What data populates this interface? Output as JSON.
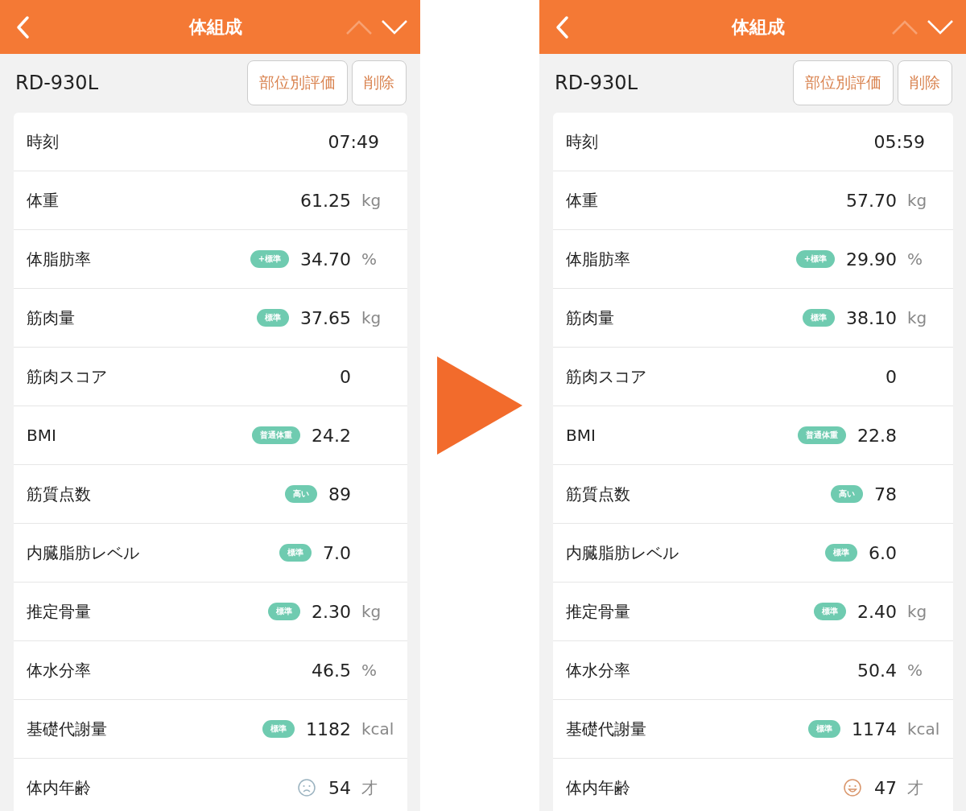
{
  "screens": [
    {
      "header": {
        "title": "体組成",
        "prev_disabled": true,
        "next_disabled": false
      },
      "device": "RD-930L",
      "buttons": [
        "部位別評価",
        "削除"
      ],
      "rows": [
        {
          "kind": "time",
          "label": "時刻",
          "value": "07:49"
        },
        {
          "kind": "measure",
          "label": "体重",
          "value": "61.25",
          "unit": "kg"
        },
        {
          "kind": "measure",
          "label": "体脂肪率",
          "badge": "+標準",
          "value": "34.70",
          "unit": "%"
        },
        {
          "kind": "measure",
          "label": "筋肉量",
          "badge": "標準",
          "value": "37.65",
          "unit": "kg"
        },
        {
          "kind": "measure",
          "label": "筋肉スコア",
          "value": "0"
        },
        {
          "kind": "measure",
          "label": "BMI",
          "badge": "普通体重",
          "value": "24.2"
        },
        {
          "kind": "measure",
          "label": "筋質点数",
          "badge": "高い",
          "value": "89"
        },
        {
          "kind": "measure",
          "label": "内臓脂肪レベル",
          "badge": "標準",
          "value": "7.0"
        },
        {
          "kind": "measure",
          "label": "推定骨量",
          "badge": "標準",
          "value": "2.30",
          "unit": "kg"
        },
        {
          "kind": "measure",
          "label": "体水分率",
          "value": "46.5",
          "unit": "%"
        },
        {
          "kind": "measure",
          "label": "基礎代謝量",
          "badge": "標準",
          "value": "1182",
          "unit": "kcal"
        },
        {
          "kind": "measure",
          "label": "体内年齢",
          "face": {
            "kind": "sad"
          },
          "value": "54",
          "unit": "才"
        }
      ]
    },
    {
      "header": {
        "title": "体組成",
        "prev_disabled": true,
        "next_disabled": false
      },
      "device": "RD-930L",
      "buttons": [
        "部位別評価",
        "削除"
      ],
      "rows": [
        {
          "kind": "time",
          "label": "時刻",
          "value": "05:59"
        },
        {
          "kind": "measure",
          "label": "体重",
          "value": "57.70",
          "unit": "kg"
        },
        {
          "kind": "measure",
          "label": "体脂肪率",
          "badge": "+標準",
          "value": "29.90",
          "unit": "%"
        },
        {
          "kind": "measure",
          "label": "筋肉量",
          "badge": "標準",
          "value": "38.10",
          "unit": "kg"
        },
        {
          "kind": "measure",
          "label": "筋肉スコア",
          "value": "0"
        },
        {
          "kind": "measure",
          "label": "BMI",
          "badge": "普通体重",
          "value": "22.8"
        },
        {
          "kind": "measure",
          "label": "筋質点数",
          "badge": "高い",
          "value": "78"
        },
        {
          "kind": "measure",
          "label": "内臓脂肪レベル",
          "badge": "標準",
          "value": "6.0"
        },
        {
          "kind": "measure",
          "label": "推定骨量",
          "badge": "標準",
          "value": "2.40",
          "unit": "kg"
        },
        {
          "kind": "measure",
          "label": "体水分率",
          "value": "50.4",
          "unit": "%"
        },
        {
          "kind": "measure",
          "label": "基礎代謝量",
          "badge": "標準",
          "value": "1174",
          "unit": "kcal"
        },
        {
          "kind": "measure",
          "label": "体内年齢",
          "face": {
            "kind": "happy"
          },
          "value": "47",
          "unit": "才"
        }
      ]
    }
  ]
}
